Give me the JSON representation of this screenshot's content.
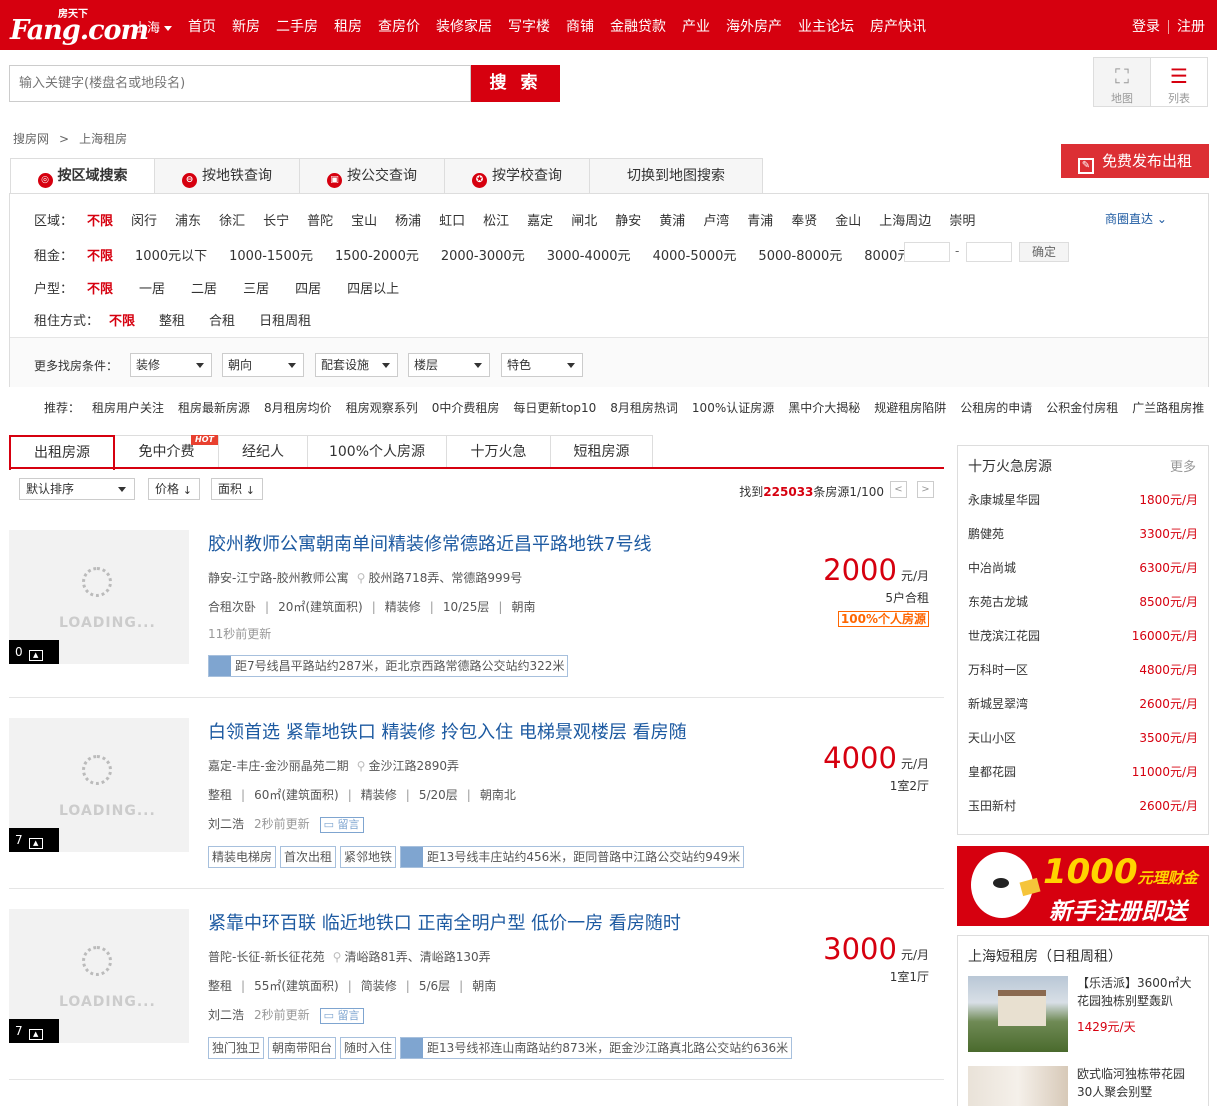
{
  "header": {
    "logo_text": "Fang.com",
    "logo_cn": "房天下",
    "city": "上海",
    "nav": [
      "首页",
      "新房",
      "二手房",
      "租房",
      "查房价",
      "装修家居",
      "写字楼",
      "商铺",
      "金融贷款",
      "产业",
      "海外房产",
      "业主论坛",
      "房产快讯"
    ],
    "login": "登录",
    "register": "注册"
  },
  "search": {
    "placeholder": "输入关键字(楼盘名或地段名)",
    "button": "搜 索"
  },
  "view_toggle": {
    "map": "地图",
    "list": "列表"
  },
  "breadcrumb": [
    "搜房网",
    ">",
    "上海租房"
  ],
  "publish_button": "免费发布出租",
  "search_tabs": [
    "按区域搜索",
    "按地铁查询",
    "按公交查询",
    "按学校查询",
    "切换到地图搜索"
  ],
  "filters": {
    "district": {
      "label": "区域：",
      "options": [
        "不限",
        "闵行",
        "浦东",
        "徐汇",
        "长宁",
        "普陀",
        "宝山",
        "杨浦",
        "虹口",
        "松江",
        "嘉定",
        "闸北",
        "静安",
        "黄浦",
        "卢湾",
        "青浦",
        "奉贤",
        "金山",
        "上海周边",
        "崇明"
      ],
      "shangquan": "商圈直达"
    },
    "rent": {
      "label": "租金：",
      "options": [
        "不限",
        "1000元以下",
        "1000-1500元",
        "1500-2000元",
        "2000-3000元",
        "3000-4000元",
        "4000-5000元",
        "5000-8000元",
        "8000元以上"
      ],
      "dash": "-",
      "confirm": "确定"
    },
    "layout": {
      "label": "户型：",
      "options": [
        "不限",
        "一居",
        "二居",
        "三居",
        "四居",
        "四居以上"
      ]
    },
    "mode": {
      "label": "租住方式：",
      "options": [
        "不限",
        "整租",
        "合租",
        "日租周租"
      ]
    },
    "more_label": "更多找房条件：",
    "more": [
      "装修",
      "朝向",
      "配套设施",
      "楼层",
      "特色"
    ]
  },
  "recommend": {
    "label": "推荐：",
    "items": [
      "租房用户关注",
      "租房最新房源",
      "8月租房均价",
      "租房观察系列",
      "0中介费租房",
      "每日更新top10",
      "8月租房热词",
      "100%认证房源",
      "黑中介大揭秘",
      "规避租房陷阱",
      "公租房的申请",
      "公积金付房租",
      "广兰路租房推"
    ]
  },
  "list_tabs": [
    "出租房源",
    "免中介费",
    "经纪人",
    "100%个人房源",
    "十万火急",
    "短租房源"
  ],
  "hot_badge": "HOT",
  "sort": {
    "default": "默认排序",
    "price": "价格",
    "area": "面积"
  },
  "found": {
    "prefix": "找到",
    "count": "225033",
    "suffix": "条房源1/100"
  },
  "listings": [
    {
      "title": "胶州教师公寓朝南单间精装修常德路近昌平路地铁7号线",
      "district": "静安-江宁路-胶州教师公寓",
      "address": "胶州路718弄、常德路999号",
      "attrs": [
        "合租次卧",
        "20㎡(建筑面积)",
        "精装修",
        "10/25层",
        "朝南"
      ],
      "agent": "",
      "updated": "11秒前更新",
      "tags": [],
      "traffic": "距7号线昌平路站约287米，距北京西路常德路公交站约322米",
      "price": "2000",
      "unit": "元/月",
      "type": "5户合租",
      "badge": "100%个人房源",
      "photos": "0",
      "has_message": false
    },
    {
      "title": "白领首选 紧靠地铁口 精装修 拎包入住 电梯景观楼层 看房随",
      "district": "嘉定-丰庄-金沙丽晶苑二期",
      "address": "金沙江路2890弄",
      "attrs": [
        "整租",
        "60㎡(建筑面积)",
        "精装修",
        "5/20层",
        "朝南北"
      ],
      "agent": "刘二浩",
      "updated": "2秒前更新",
      "message": "留言",
      "tags": [
        "精装电梯房",
        "首次出租",
        "紧邻地铁"
      ],
      "traffic": "距13号线丰庄站约456米，距同普路中江路公交站约949米",
      "price": "4000",
      "unit": "元/月",
      "type": "1室2厅",
      "badge": "",
      "photos": "7",
      "has_message": true
    },
    {
      "title": "紧靠中环百联 临近地铁口 正南全明户型 低价一房 看房随时",
      "district": "普陀-长征-新长征花苑",
      "address": "清峪路81弄、清峪路130弄",
      "attrs": [
        "整租",
        "55㎡(建筑面积)",
        "简装修",
        "5/6层",
        "朝南"
      ],
      "agent": "刘二浩",
      "updated": "2秒前更新",
      "message": "留言",
      "tags": [
        "独门独卫",
        "朝南带阳台",
        "随时入住"
      ],
      "traffic": "距13号线祁连山南路站约873米，距金沙江路真北路公交站约636米",
      "price": "3000",
      "unit": "元/月",
      "type": "1室1厅",
      "badge": "",
      "photos": "7",
      "has_message": true
    }
  ],
  "loading_text": "LOADING...",
  "urgent": {
    "title": "十万火急房源",
    "more": "更多",
    "items": [
      {
        "name": "永康城星华园",
        "price": "1800元/月"
      },
      {
        "name": "鹏健苑",
        "price": "3300元/月"
      },
      {
        "name": "中冶尚城",
        "price": "6300元/月"
      },
      {
        "name": "东苑古龙城",
        "price": "8500元/月"
      },
      {
        "name": "世茂滨江花园",
        "price": "16000元/月"
      },
      {
        "name": "万科时一区",
        "price": "4800元/月"
      },
      {
        "name": "新城昱翠湾",
        "price": "2600元/月"
      },
      {
        "name": "天山小区",
        "price": "3500元/月"
      },
      {
        "name": "皇都花园",
        "price": "11000元/月"
      },
      {
        "name": "玉田新村",
        "price": "2600元/月"
      }
    ]
  },
  "banner": {
    "amount": "1000",
    "unit": "元",
    "suffix": "理财金",
    "slogan": "新手注册即送"
  },
  "short_rent": {
    "title": "上海短租房（日租周租）",
    "item1": {
      "desc": "【乐活派】3600㎡大花园独栋别墅轰趴",
      "price": "1429元/天"
    },
    "item2": {
      "desc": "欧式临河独栋带花园30人聚会别墅"
    }
  }
}
